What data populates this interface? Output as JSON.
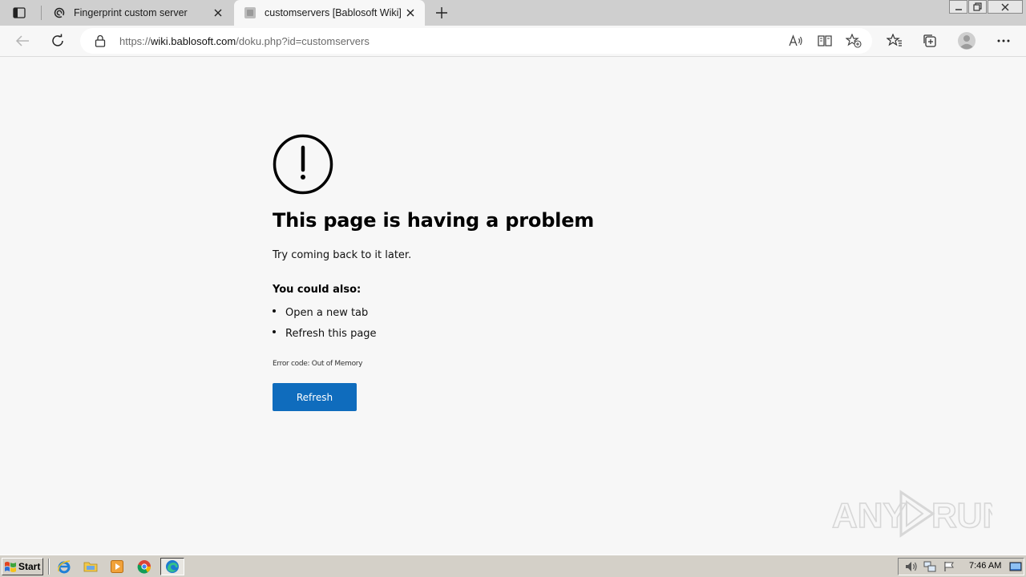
{
  "tabs": [
    {
      "title": "Fingerprint custom server",
      "favicon": "fingerprint-icon",
      "active": false
    },
    {
      "title": "customservers [Bablosoft Wiki]",
      "favicon": "page-icon",
      "active": true
    }
  ],
  "address_bar": {
    "scheme": "https://",
    "host": "wiki.bablosoft.com",
    "path": "/doku.php?id=customservers"
  },
  "error_page": {
    "title": "This page is having a problem",
    "subtitle": "Try coming back to it later.",
    "also_heading": "You could also:",
    "suggestions": [
      "Open a new tab",
      "Refresh this page"
    ],
    "error_code": "Error code: Out of Memory",
    "refresh_label": "Refresh"
  },
  "watermark": {
    "text": "ANY RUN"
  },
  "taskbar": {
    "start_label": "Start",
    "clock": "7:46 AM",
    "apps": [
      "internet-explorer-icon",
      "folder-icon",
      "media-player-icon",
      "chrome-icon",
      "edge-icon"
    ]
  },
  "colors": {
    "accent": "#0f6cbd",
    "page_background": "#f7f7f7",
    "tabstrip": "#cfcfcf",
    "taskbar": "#d4d0c8"
  }
}
